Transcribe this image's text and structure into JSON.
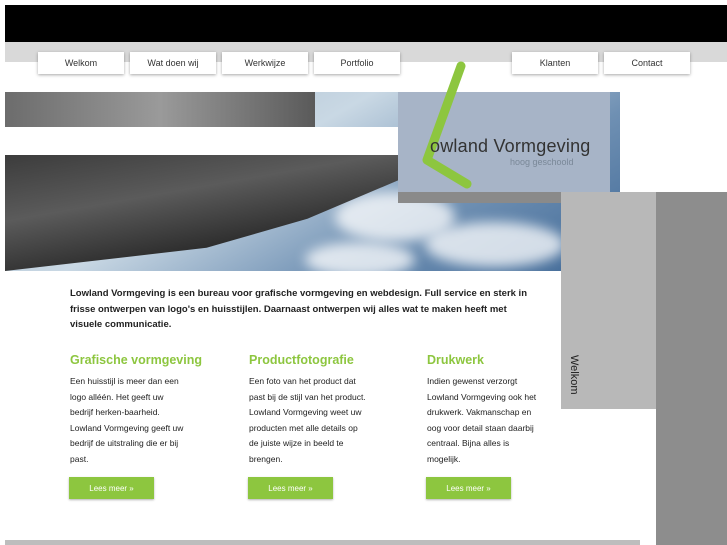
{
  "nav": {
    "welkom": "Welkom",
    "wat_doen_wij": "Wat doen wij",
    "werkwijze": "Werkwijze",
    "portfolio": "Portfolio",
    "klanten": "Klanten",
    "contact": "Contact"
  },
  "logo": {
    "title": "owland Vormgeving",
    "tagline": "hoog geschoold"
  },
  "side_label": "Welkom",
  "intro": "Lowland Vormgeving is een bureau voor grafische vormgeving en webdesign. Full service en sterk in frisse ontwerpen van logo's en huisstijlen. Daarnaast ontwerpen wij alles wat te maken heeft met visuele communicatie.",
  "columns": [
    {
      "title": "Grafische vormgeving",
      "text": "Een huisstijl is meer dan een logo alléén. Het geeft uw bedrijf herken-baarheid. Lowland Vormgeving geeft uw bedrijf de uitstraling die er bij past.",
      "button": "Lees meer »"
    },
    {
      "title": "Productfotografie",
      "text": "Een foto van het product dat past bij de stijl van het product. Lowland Vormgeving weet uw producten met alle details op de juiste wijze in beeld te brengen.",
      "button": "Lees meer »"
    },
    {
      "title": "Drukwerk",
      "text": "Indien gewenst verzorgt Lowland Vormgeving ook het drukwerk. Vakmanschap en oog voor detail staan daarbij centraal. Bijna alles is mogelijk.",
      "button": "Lees meer »"
    }
  ],
  "colors": {
    "accent_green": "#8dc63f",
    "logo_box": "#a7b4c7",
    "side_gray": "#b8b8b8"
  }
}
